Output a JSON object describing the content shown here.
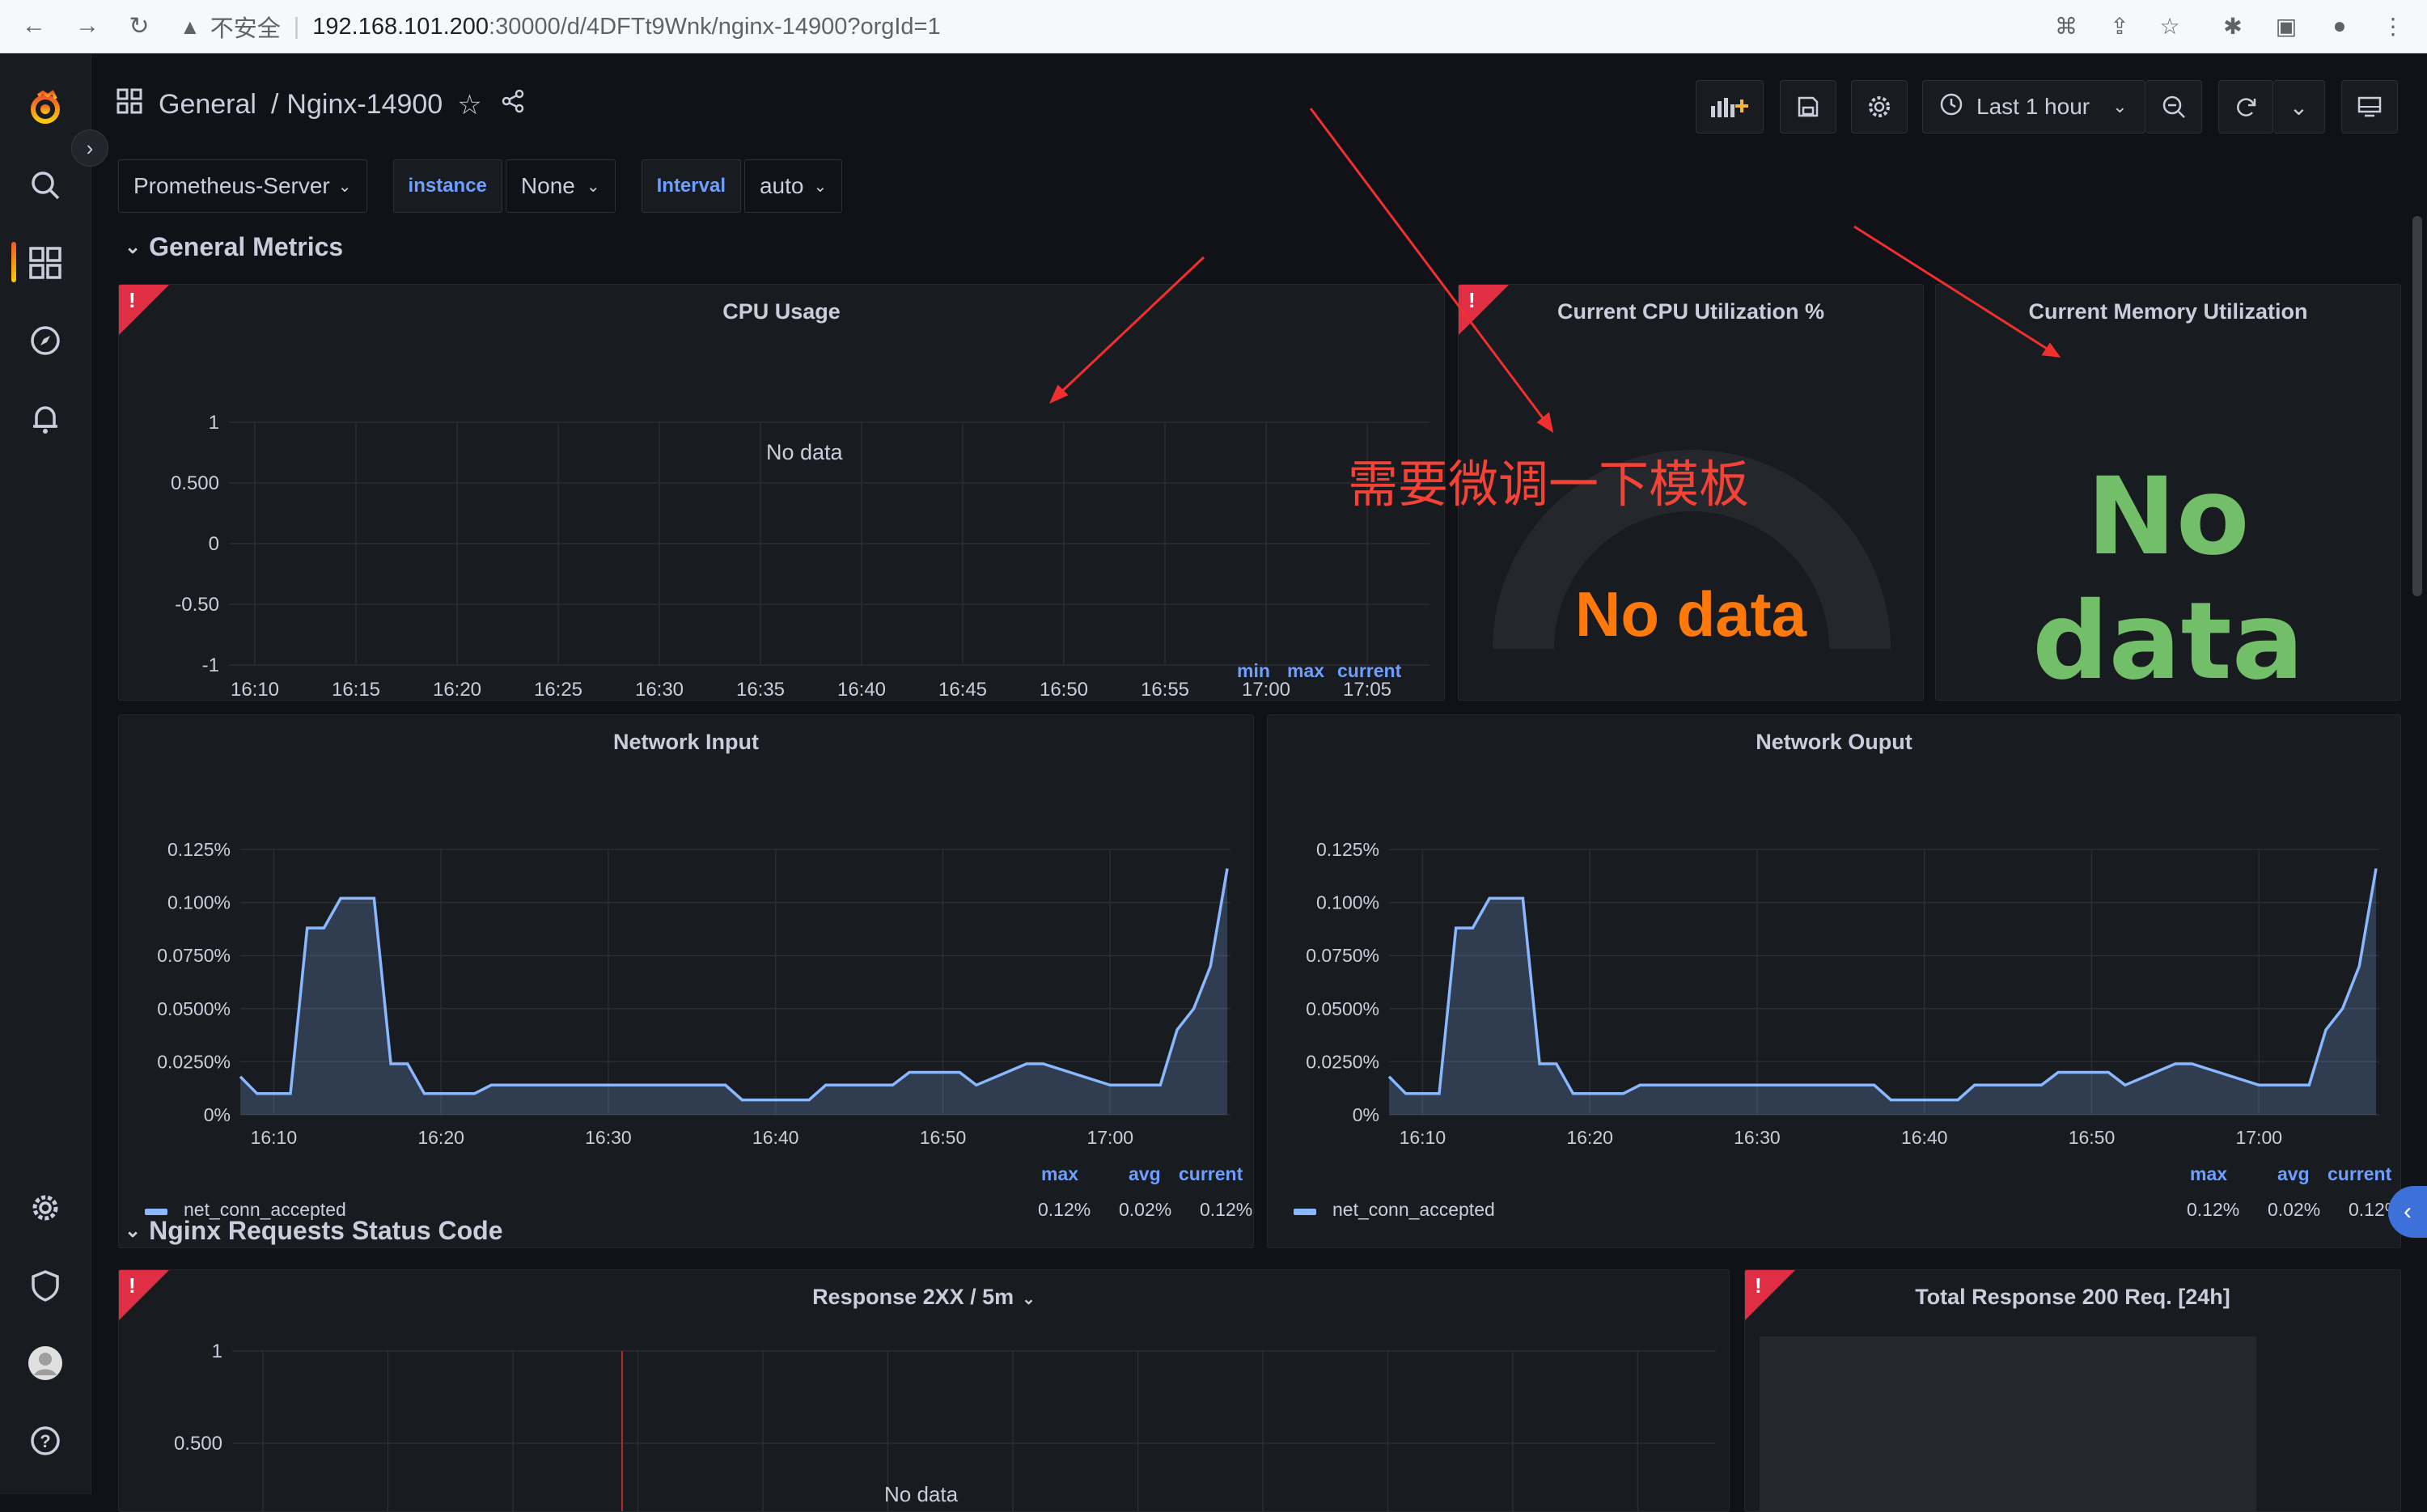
{
  "browser": {
    "insecure_label": "不安全",
    "url_host": "192.168.101.200",
    "url_path": ":30000/d/4DFTt9Wnk/nginx-14900?orgId=1"
  },
  "header": {
    "crumb_folder": "General",
    "crumb_sep": "/",
    "crumb_dashboard": "Nginx-14900",
    "time_range": "Last 1 hour"
  },
  "variables": {
    "datasource": "Prometheus-Server",
    "instance_label": "instance",
    "instance_value": "None",
    "interval_label": "Interval",
    "interval_value": "auto"
  },
  "rows": {
    "general": "General Metrics",
    "status": "Nginx Requests Status Code"
  },
  "panels": {
    "cpu_usage": {
      "title": "CPU Usage",
      "no_data": "No data",
      "y_ticks": [
        "1",
        "0.500",
        "0",
        "-0.50",
        "-1"
      ],
      "x_ticks": [
        "16:10",
        "16:15",
        "16:20",
        "16:25",
        "16:30",
        "16:35",
        "16:40",
        "16:45",
        "16:50",
        "16:55",
        "17:00",
        "17:05"
      ],
      "legend": [
        "min",
        "max",
        "current"
      ]
    },
    "cpu_util": {
      "title": "Current CPU Utilization %",
      "no_data": "No data"
    },
    "mem_util": {
      "title": "Current Memory Utilization",
      "no_data": "No data"
    },
    "net_in": {
      "title": "Network Input",
      "y_ticks": [
        "0.125%",
        "0.100%",
        "0.0750%",
        "0.0500%",
        "0.0250%",
        "0%"
      ],
      "x_ticks": [
        "16:10",
        "16:20",
        "16:30",
        "16:40",
        "16:50",
        "17:00"
      ],
      "legend_cols": [
        "max",
        "avg",
        "current"
      ],
      "series_name": "net_conn_accepted",
      "series_values": [
        "0.12%",
        "0.02%",
        "0.12%"
      ]
    },
    "net_out": {
      "title": "Network Ouput",
      "y_ticks": [
        "0.125%",
        "0.100%",
        "0.0750%",
        "0.0500%",
        "0.0250%",
        "0%"
      ],
      "x_ticks": [
        "16:10",
        "16:20",
        "16:30",
        "16:40",
        "16:50",
        "17:00"
      ],
      "legend_cols": [
        "max",
        "avg",
        "current"
      ],
      "series_name": "net_conn_accepted",
      "series_values": [
        "0.12%",
        "0.02%",
        "0.12%"
      ]
    },
    "resp2xx": {
      "title": "Response 2XX / 5m",
      "y_ticks": [
        "1",
        "0.500"
      ],
      "no_data": "No data"
    },
    "total200": {
      "title": "Total Response 200 Req. [24h]"
    }
  },
  "annotation": {
    "text": "需要微调一下模板"
  },
  "chart_data": [
    {
      "type": "area",
      "name_ref": "net_in",
      "series": [
        {
          "name": "net_conn_accepted",
          "x": [
            "16:08",
            "16:09",
            "16:10",
            "16:11",
            "16:12",
            "16:13",
            "16:14",
            "16:15",
            "16:16",
            "16:17",
            "16:18",
            "16:19",
            "16:20",
            "16:22",
            "16:23",
            "16:25",
            "16:30",
            "16:35",
            "16:37",
            "16:38",
            "16:40",
            "16:42",
            "16:43",
            "16:45",
            "16:47",
            "16:48",
            "16:50",
            "16:51",
            "16:52",
            "16:55",
            "16:56",
            "17:00",
            "17:01",
            "17:02",
            "17:03",
            "17:04",
            "17:05",
            "17:06",
            "17:07"
          ],
          "values": [
            0.018,
            0.01,
            0.01,
            0.01,
            0.088,
            0.088,
            0.102,
            0.102,
            0.102,
            0.024,
            0.024,
            0.01,
            0.01,
            0.01,
            0.014,
            0.014,
            0.014,
            0.014,
            0.014,
            0.007,
            0.007,
            0.007,
            0.014,
            0.014,
            0.014,
            0.02,
            0.02,
            0.02,
            0.014,
            0.024,
            0.024,
            0.014,
            0.014,
            0.014,
            0.014,
            0.04,
            0.05,
            0.07,
            0.116
          ]
        }
      ]
    }
  ]
}
